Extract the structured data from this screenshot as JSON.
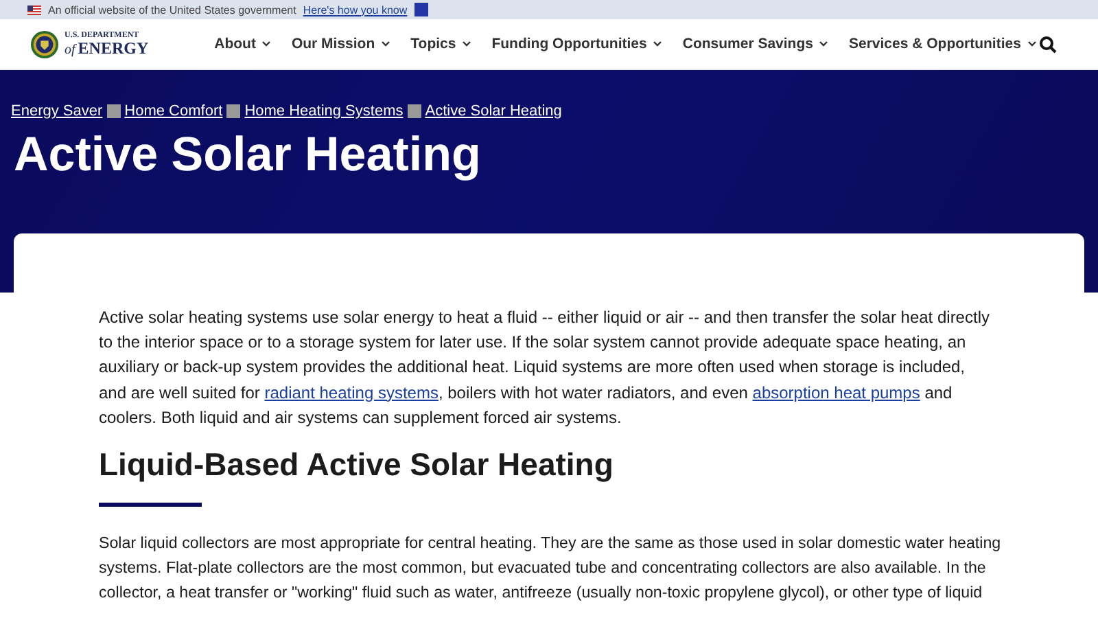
{
  "gov_banner": {
    "text": "An official website of the United States government",
    "link": "Here's how you know"
  },
  "logo": {
    "line_1": "U.S. DEPARTMENT",
    "line_2_prefix": "of",
    "line_2": "ENERGY"
  },
  "nav": {
    "items": [
      {
        "label": "About"
      },
      {
        "label": "Our Mission"
      },
      {
        "label": "Topics"
      },
      {
        "label": "Funding Opportunities"
      },
      {
        "label": "Consumer Savings"
      },
      {
        "label": "Services & Opportunities"
      }
    ]
  },
  "breadcrumbs": [
    {
      "label": "Energy Saver"
    },
    {
      "label": "Home Comfort"
    },
    {
      "label": "Home Heating Systems"
    },
    {
      "label": "Active Solar Heating"
    }
  ],
  "page_title": "Active Solar Heating",
  "intro": [
    {
      "kind": "text",
      "text": "Active solar heating systems use solar energy to heat a fluid -- either liquid or air -- and then transfer the solar heat directly to the interior space or to a storage system for later use. If the solar system cannot provide adequate space heating, an auxiliary or back-up system provides the additional heat. Liquid systems are more often used when storage is included, and are well suited for "
    },
    {
      "kind": "link",
      "text": "radiant heating systems"
    },
    {
      "kind": "text",
      "text": ", boilers with hot water radiators, and even "
    },
    {
      "kind": "link",
      "text": "absorption heat pumps"
    },
    {
      "kind": "text",
      "text": " and coolers. Both liquid and air systems can supplement forced air systems."
    }
  ],
  "section_heading": "Liquid-Based Active Solar Heating",
  "section_lines": [
    "Solar liquid collectors are most appropriate for central heating. They are the same as those used in solar domestic water heating",
    "systems. Flat-plate collectors are the most common, but evacuated tube and concentrating collectors are also available. In the",
    "collector, a heat transfer or \"working\" fluid such as water, antifreeze (usually non-toxic propylene glycol), or other type of liquid"
  ]
}
